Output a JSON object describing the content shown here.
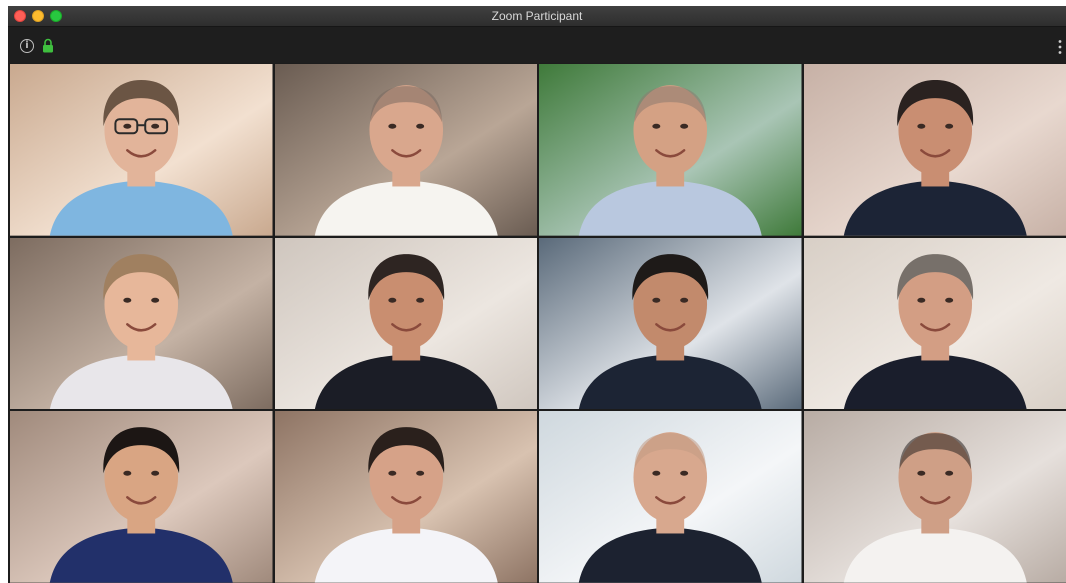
{
  "window": {
    "title": "Zoom Participant"
  },
  "toolbar": {
    "info_icon": "info-icon",
    "lock_icon": "lock-icon",
    "more_icon": "more-options-icon",
    "info_glyph": "i"
  },
  "grid": {
    "rows": 3,
    "columns": 4
  },
  "participants": [
    {
      "bg": "#c9a98f",
      "bg2": "#f2e0d0",
      "skin": "#e2b49a",
      "hair": "#6b5544",
      "shirt": "#7fb6e0",
      "glasses": true,
      "bald": false
    },
    {
      "bg": "#6a5c52",
      "bg2": "#b9a696",
      "skin": "#d9a78d",
      "hair": "#7a6a60",
      "shirt": "#f6f4f0",
      "glasses": false,
      "bald": true
    },
    {
      "bg": "#3f7a3a",
      "bg2": "#a9c5b5",
      "skin": "#d4a184",
      "hair": "#8a7a70",
      "shirt": "#b9c8df",
      "glasses": false,
      "bald": true
    },
    {
      "bg": "#c7b1a6",
      "bg2": "#e8d8cf",
      "skin": "#c98e72",
      "hair": "#2a2220",
      "shirt": "#1c2436",
      "glasses": false,
      "bald": false
    },
    {
      "bg": "#7d6c60",
      "bg2": "#c4b2a4",
      "skin": "#e7b79a",
      "hair": "#a08060",
      "shirt": "#e8e6ea",
      "glasses": false,
      "bald": false
    },
    {
      "bg": "#cfc6be",
      "bg2": "#ece6e0",
      "skin": "#c98e70",
      "hair": "#2e2522",
      "shirt": "#1b1d26",
      "glasses": false,
      "bald": false
    },
    {
      "bg": "#5a6a7a",
      "bg2": "#dfe3e8",
      "skin": "#c28a6c",
      "hair": "#1e1a18",
      "shirt": "#1c2434",
      "glasses": false,
      "bald": false
    },
    {
      "bg": "#d8cfc6",
      "bg2": "#efe9e3",
      "skin": "#d39e84",
      "hair": "#77706a",
      "shirt": "#1a1e2c",
      "glasses": false,
      "bald": false
    },
    {
      "bg": "#a08a7c",
      "bg2": "#dcc8bc",
      "skin": "#d9a583",
      "hair": "#1c1614",
      "shirt": "#22306a",
      "glasses": false,
      "bald": false
    },
    {
      "bg": "#8e7464",
      "bg2": "#d8c2b0",
      "skin": "#d6a288",
      "hair": "#2a201c",
      "shirt": "#f4f4f8",
      "glasses": false,
      "bald": false
    },
    {
      "bg": "#cfd8de",
      "bg2": "#f4f6f8",
      "skin": "#d8a88e",
      "hair": "#c29a84",
      "shirt": "#1c2230",
      "glasses": false,
      "bald": true
    },
    {
      "bg": "#b8aca4",
      "bg2": "#e6e0dc",
      "skin": "#cf9f86",
      "hair": "#2a2220",
      "shirt": "#f4f2f0",
      "glasses": false,
      "bald": true
    }
  ]
}
